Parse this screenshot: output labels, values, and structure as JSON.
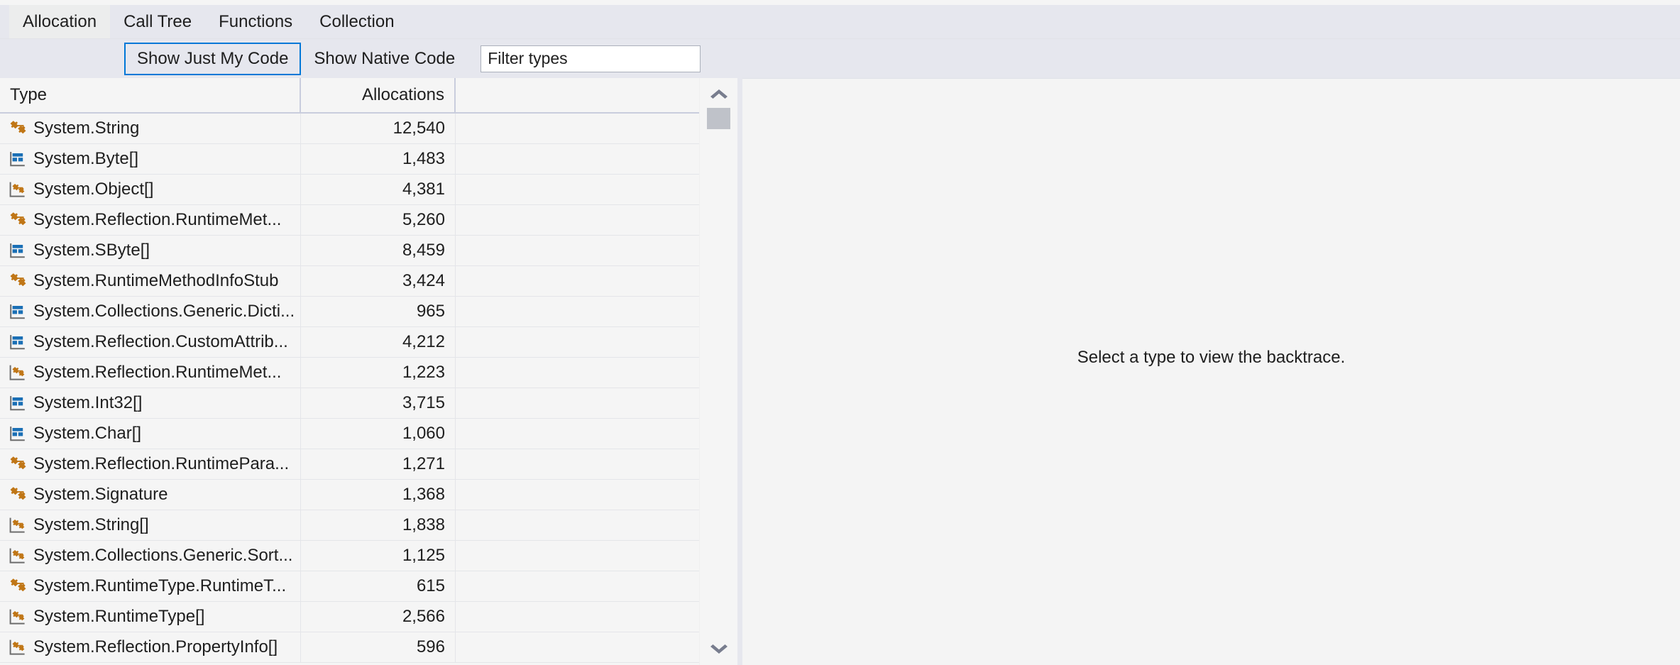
{
  "tabs": [
    {
      "label": "Allocation",
      "selected": true
    },
    {
      "label": "Call Tree",
      "selected": false
    },
    {
      "label": "Functions",
      "selected": false
    },
    {
      "label": "Collection",
      "selected": false
    }
  ],
  "toolbar": {
    "show_just_my_code_label": "Show Just My Code",
    "show_native_code_label": "Show Native Code",
    "filter_placeholder": "Filter types",
    "filter_value": ""
  },
  "grid": {
    "columns": [
      "Type",
      "Allocations",
      ""
    ],
    "rows": [
      {
        "icon": "class-icon",
        "type": "System.String",
        "allocations": "12,540"
      },
      {
        "icon": "struct-icon",
        "type": "System.Byte[]",
        "allocations": "1,483"
      },
      {
        "icon": "array-icon",
        "type": "System.Object[]",
        "allocations": "4,381"
      },
      {
        "icon": "class-icon",
        "type": "System.Reflection.RuntimeMet...",
        "allocations": "5,260"
      },
      {
        "icon": "struct-icon",
        "type": "System.SByte[]",
        "allocations": "8,459"
      },
      {
        "icon": "class-icon",
        "type": "System.RuntimeMethodInfoStub",
        "allocations": "3,424"
      },
      {
        "icon": "struct-icon",
        "type": "System.Collections.Generic.Dicti...",
        "allocations": "965"
      },
      {
        "icon": "struct-icon",
        "type": "System.Reflection.CustomAttrib...",
        "allocations": "4,212"
      },
      {
        "icon": "array-icon",
        "type": "System.Reflection.RuntimeMet...",
        "allocations": "1,223"
      },
      {
        "icon": "struct-icon",
        "type": "System.Int32[]",
        "allocations": "3,715"
      },
      {
        "icon": "struct-icon",
        "type": "System.Char[]",
        "allocations": "1,060"
      },
      {
        "icon": "class-icon",
        "type": "System.Reflection.RuntimePara...",
        "allocations": "1,271"
      },
      {
        "icon": "class-icon",
        "type": "System.Signature",
        "allocations": "1,368"
      },
      {
        "icon": "array-icon",
        "type": "System.String[]",
        "allocations": "1,838"
      },
      {
        "icon": "array-icon",
        "type": "System.Collections.Generic.Sort...",
        "allocations": "1,125"
      },
      {
        "icon": "class-icon",
        "type": "System.RuntimeType.RuntimeT...",
        "allocations": "615"
      },
      {
        "icon": "array-icon",
        "type": "System.RuntimeType[]",
        "allocations": "2,566"
      },
      {
        "icon": "array-icon",
        "type": "System.Reflection.PropertyInfo[]",
        "allocations": "596"
      }
    ]
  },
  "scrollbar": {
    "up_arrow": "chevron-up",
    "down_arrow": "chevron-down"
  },
  "details": {
    "placeholder": "Select a type to view the backtrace."
  },
  "colors": {
    "accent": "#0078d7",
    "class_icon": "#c07616",
    "struct_icon": "#1a6fb5",
    "tabstrip_bg": "#e6e7ee",
    "grid_bg": "#f5f5f5",
    "scroll_thumb": "#bfc2c9"
  }
}
